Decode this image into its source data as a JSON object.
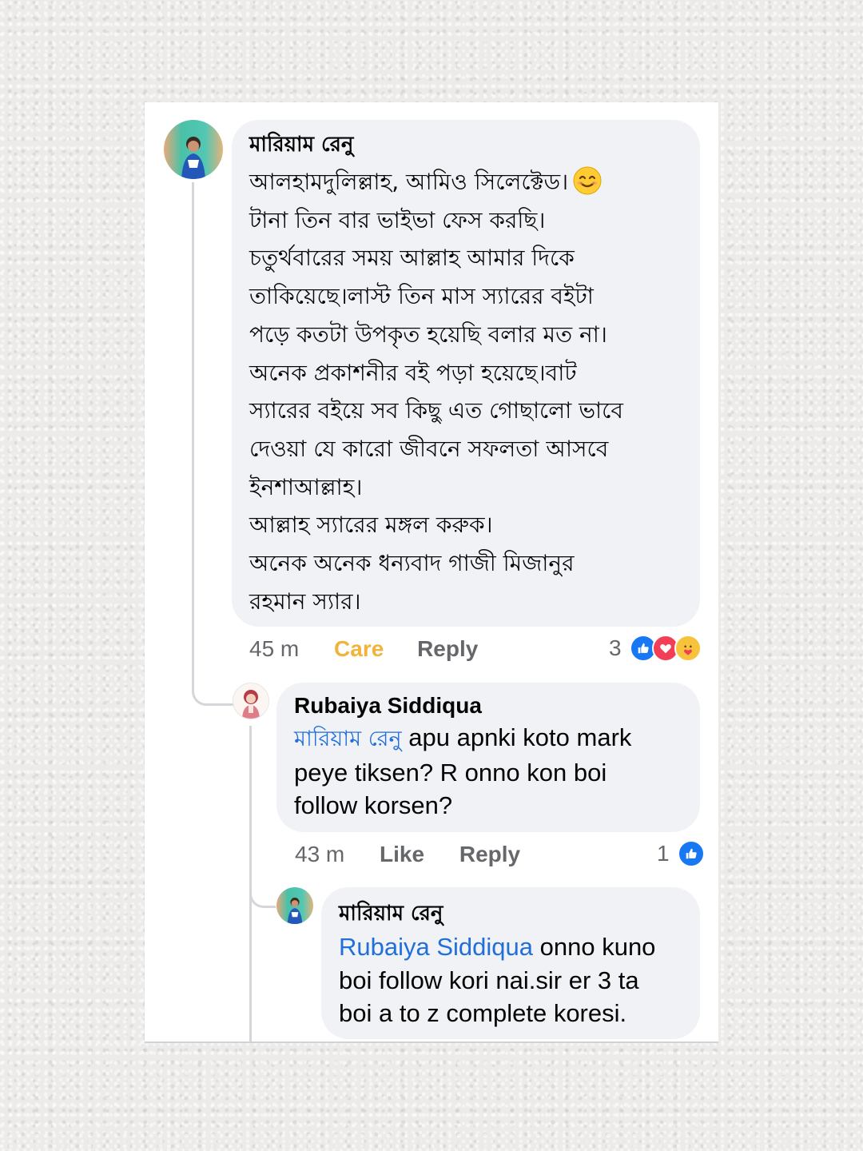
{
  "comments": [
    {
      "author": "মারিয়াম রেনু",
      "lines": [
        "আলহামদুলিল্লাহ, আমিও সিলেক্টেড।",
        "টানা তিন বার ভাইভা ফেস করছি।",
        "চতুর্থবারের সময় আল্লাহ আমার দিকে",
        "তাকিয়েছে।লাস্ট তিন মাস স্যারের বইটা",
        "পড়ে কতটা উপকৃত হয়েছি বলার মত না।",
        "অনেক প্রকাশনীর বই পড়া হয়েছে।বাট",
        "স্যারের বইয়ে সব কিছু এত গোছালো ভাবে",
        "দেওয়া যে কারো জীবনে সফলতা আসবে",
        "ইনশাআল্লাহ।",
        "আল্লাহ স্যারের মঙ্গল করুক।",
        "অনেক অনেক ধন্যবাদ গাজী মিজানুর",
        "রহমান স্যার।"
      ],
      "emoji": "smiling-face-icon",
      "time": "45 m",
      "reaction_action": "Care",
      "reply": "Reply",
      "reaction_count": "3",
      "reaction_icons": [
        "like-icon",
        "love-icon",
        "care-icon"
      ]
    },
    {
      "author": "Rubaiya Siddiqua",
      "mention": "মারিয়াম রেনু",
      "line1_rest": " apu apnki koto mark",
      "lines": [
        "peye tiksen? R onno kon boi",
        "follow korsen?"
      ],
      "time": "43 m",
      "reaction_action": "Like",
      "reply": "Reply",
      "reaction_count": "1",
      "reaction_icons": [
        "like-icon"
      ]
    },
    {
      "author": "মারিয়াম রেনু",
      "mention": "Rubaiya Siddiqua",
      "line1_rest": " onno kuno",
      "lines": [
        "boi follow kori nai.sir er  3 ta",
        "boi a to z complete koresi."
      ]
    }
  ],
  "colors": {
    "bubble": "#f0f2f5",
    "mention": "#216fdb",
    "meta": "#65676b",
    "care": "#f2b33a",
    "like": "#1877f2",
    "love": "#f33e58"
  }
}
